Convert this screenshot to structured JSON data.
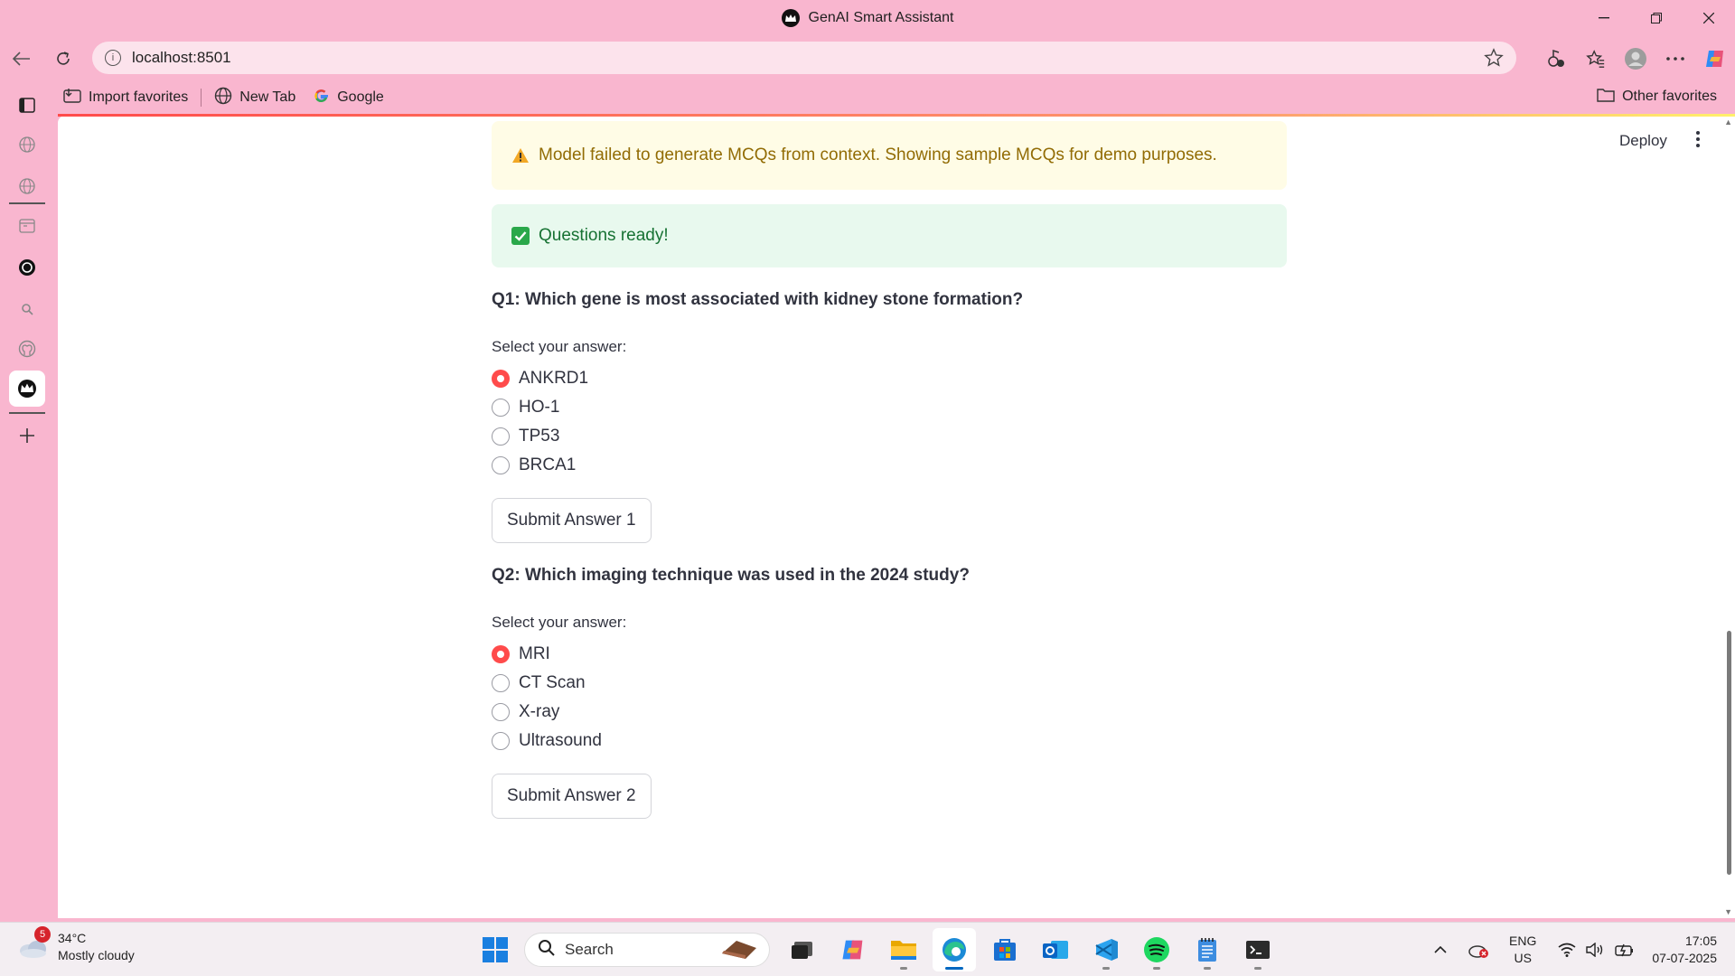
{
  "window": {
    "title": "GenAI Smart Assistant"
  },
  "browser": {
    "url": "localhost:8501",
    "favorites": [
      {
        "label": "Import favorites",
        "icon": "import-icon"
      },
      {
        "label": "New Tab",
        "icon": "globe-icon"
      },
      {
        "label": "Google",
        "icon": "google-icon"
      }
    ],
    "other_favorites": "Other favorites"
  },
  "app": {
    "deploy_label": "Deploy",
    "warning": "Model failed to generate MCQs from context. Showing sample MCQs for demo purposes.",
    "success": "Questions ready!",
    "questions": [
      {
        "title": "Q1: Which gene is most associated with kidney stone formation?",
        "prompt": "Select your answer:",
        "options": [
          "ANKRD1",
          "HO-1",
          "TP53",
          "BRCA1"
        ],
        "selected": "ANKRD1",
        "submit_label": "Submit Answer 1"
      },
      {
        "title": "Q2: Which imaging technique was used in the 2024 study?",
        "prompt": "Select your answer:",
        "options": [
          "MRI",
          "CT Scan",
          "X-ray",
          "Ultrasound"
        ],
        "selected": "MRI",
        "submit_label": "Submit Answer 2"
      }
    ]
  },
  "taskbar": {
    "weather": {
      "temp": "34°C",
      "condition": "Mostly cloudy",
      "alert_count": "5"
    },
    "search_placeholder": "Search",
    "lang": "ENG",
    "region": "US",
    "time": "17:05",
    "date": "07-07-2025"
  },
  "colors": {
    "accent": "#ff4b4b",
    "chrome": "#f9b6cf",
    "warning_bg": "#fffce6",
    "success_bg": "#e8f9ee"
  }
}
